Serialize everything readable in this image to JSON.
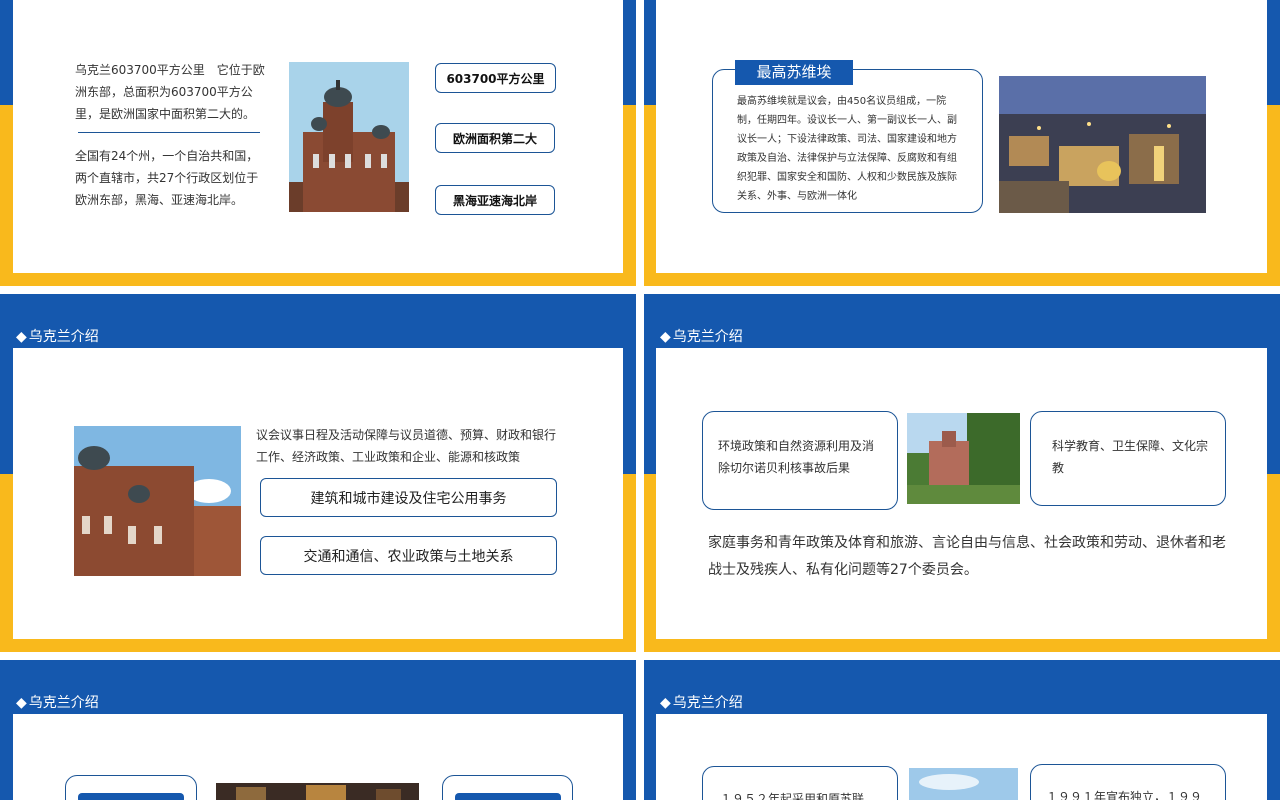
{
  "slides": {
    "s1": {
      "para1": "乌克兰603700平方公里　它位于欧洲东部，总面积为603700平方公里，是欧洲国家中面积第二大的。",
      "para2": "全国有24个州，一个自治共和国，两个直辖市，共27个行政区划位于欧洲东部，黑海、亚速海北岸。",
      "pills": [
        "603700平方公里",
        "欧洲面积第二大",
        "黑海亚速海北岸"
      ]
    },
    "s2": {
      "heading": "最高苏维埃",
      "body": "最高苏维埃就是议会，由450名议员组成，一院制，任期四年。设议长一人、第一副议长一人、副议长一人；下设法律政策、司法、国家建设和地方政策及自治、法律保护与立法保障、反腐败和有组织犯罪、国家安全和国防、人权和少数民族及族际关系、外事、与欧洲一体化"
    },
    "s3": {
      "section_title": "乌克兰介绍",
      "body": "议会议事日程及活动保障与议员道德、预算、财政和银行工作、经济政策、工业政策和企业、能源和核政策",
      "pills": [
        "建筑和城市建设及住宅公用事务",
        "交通和通信、农业政策与土地关系"
      ]
    },
    "s4": {
      "section_title": "乌克兰介绍",
      "box_left": "环境政策和自然资源利用及消除切尔诺贝利核事故后果",
      "box_right": "科学教育、卫生保障、文化宗教",
      "body": "家庭事务和青年政策及体育和旅游、言论自由与信息、社会政策和劳动、退休者和老战士及残疾人、私有化问题等27个委员会。"
    },
    "s5": {
      "section_title": "乌克兰介绍"
    },
    "s6": {
      "section_title": "乌克兰介绍",
      "box_left": "１９５２年起采用和原苏联",
      "box_right": "１９９１年宣布独立，１９９"
    }
  },
  "colors": {
    "blue": "#1558ae",
    "yellow": "#f9b91c",
    "border": "#1c5596"
  },
  "icons": {
    "section_marker": "diamond-icon"
  }
}
